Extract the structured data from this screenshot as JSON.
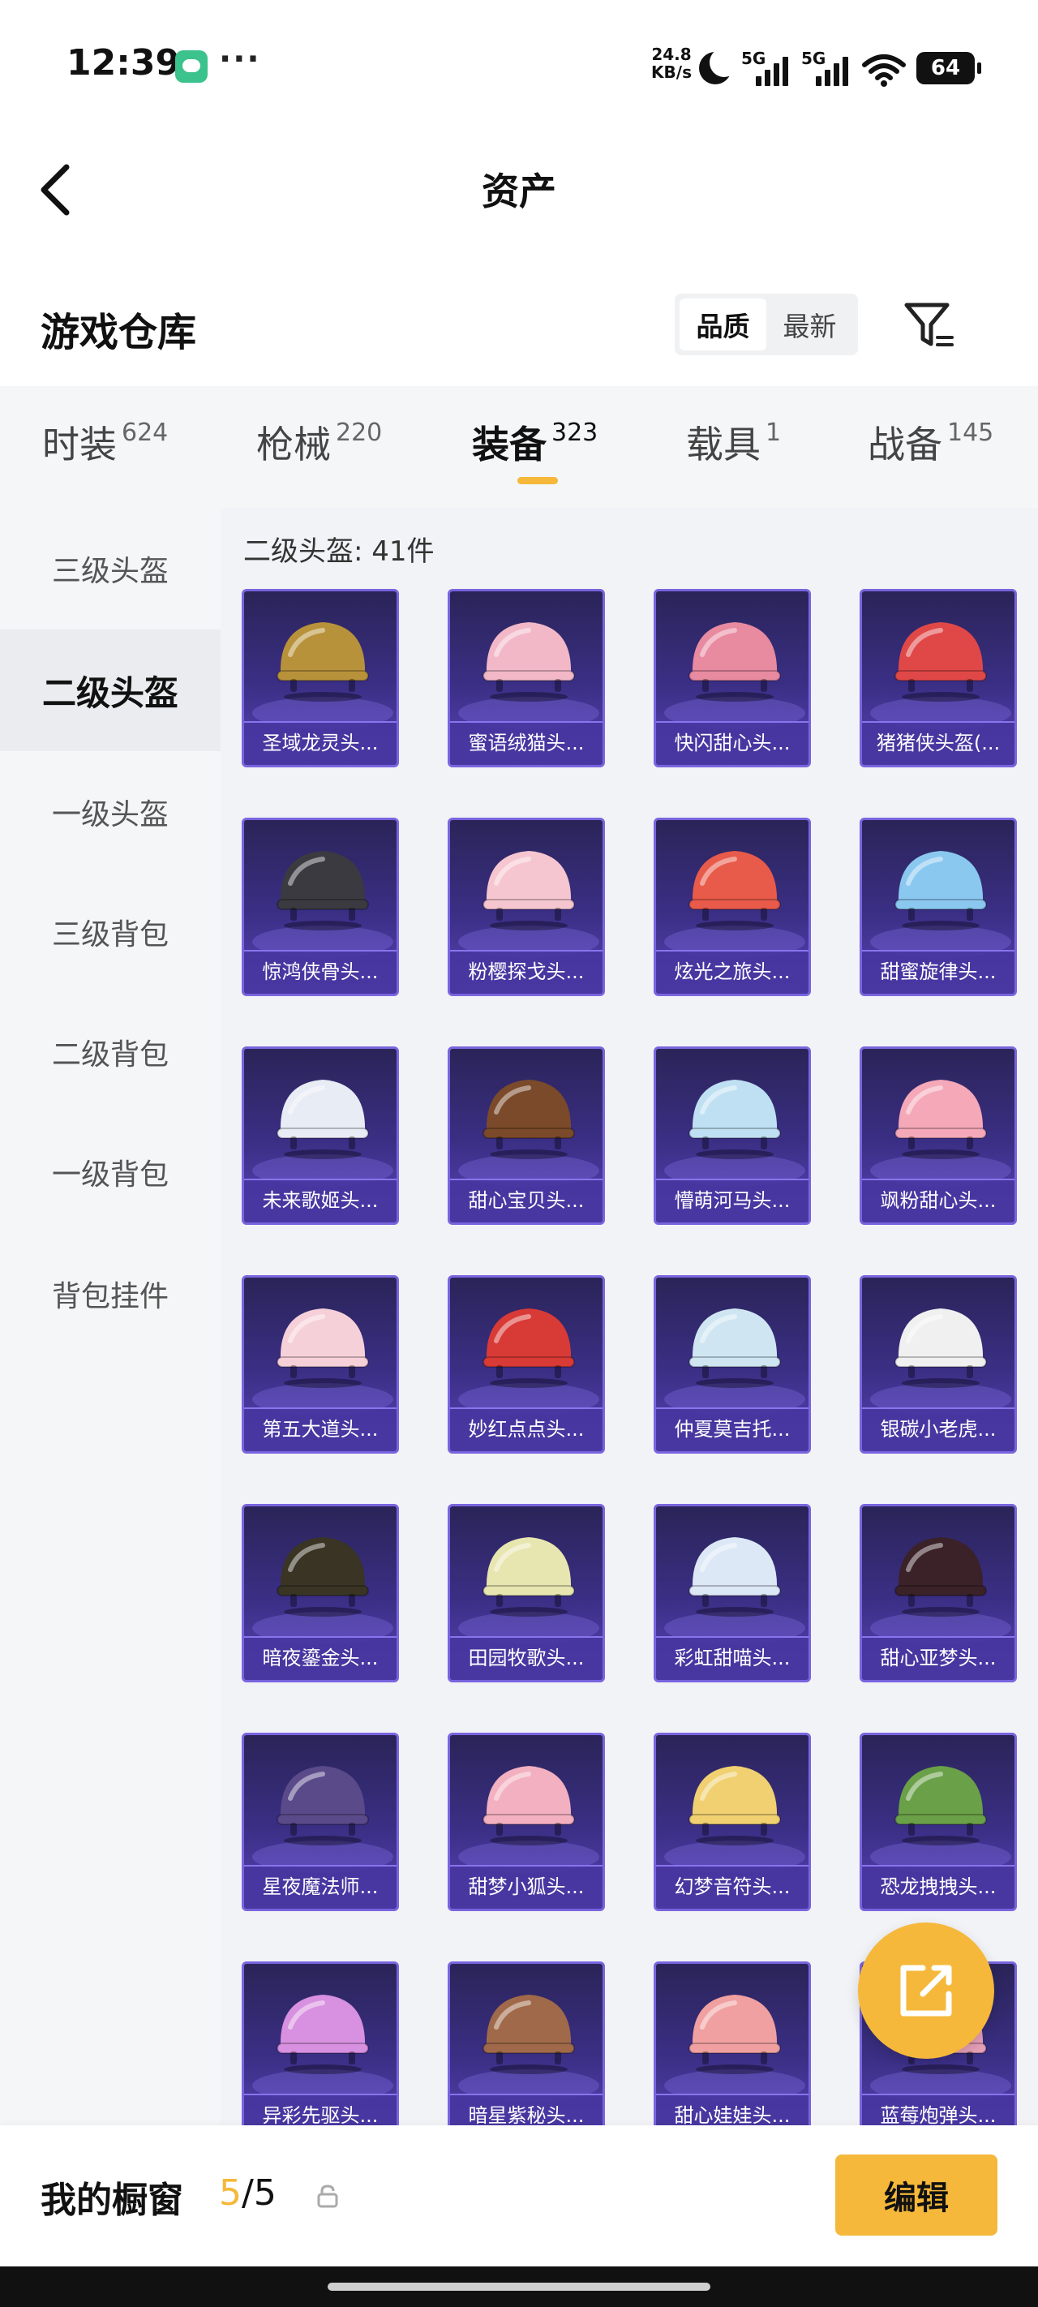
{
  "status_bar": {
    "time": "12:39",
    "more": "···",
    "net_speed_value": "24.8",
    "net_speed_unit": "KB/s",
    "signal1": "5G",
    "signal2": "5G",
    "battery": "64"
  },
  "header": {
    "title": "资产"
  },
  "section": {
    "title": "游戏仓库",
    "sort_options": [
      "品质",
      "最新"
    ],
    "active_sort": "品质"
  },
  "tabs": [
    {
      "label": "时装",
      "count": "624"
    },
    {
      "label": "枪械",
      "count": "220"
    },
    {
      "label": "装备",
      "count": "323"
    },
    {
      "label": "载具",
      "count": "1"
    },
    {
      "label": "战备",
      "count": "145"
    }
  ],
  "active_tab": "装备",
  "sidebar": {
    "items": [
      "三级头盔",
      "二级头盔",
      "一级头盔",
      "三级背包",
      "二级背包",
      "一级背包",
      "背包挂件"
    ],
    "active": "二级头盔"
  },
  "content": {
    "count_label": "二级头盔: 41件",
    "items": [
      {
        "name": "圣域龙灵头...",
        "color": "#b8923a"
      },
      {
        "name": "蜜语绒猫头...",
        "color": "#f2b8c8"
      },
      {
        "name": "快闪甜心头...",
        "color": "#e88aa0"
      },
      {
        "name": "猪猪侠头盔(...",
        "color": "#e04848"
      },
      {
        "name": "惊鸿侠骨头...",
        "color": "#3a3a40"
      },
      {
        "name": "粉樱探戈头...",
        "color": "#f6c6d0"
      },
      {
        "name": "炫光之旅头...",
        "color": "#e85a4a"
      },
      {
        "name": "甜蜜旋律头...",
        "color": "#8ac8f0"
      },
      {
        "name": "未来歌姬头...",
        "color": "#e8ecf4"
      },
      {
        "name": "甜心宝贝头...",
        "color": "#7a4a2a"
      },
      {
        "name": "懵萌河马头...",
        "color": "#bfe0f2"
      },
      {
        "name": "飒粉甜心头...",
        "color": "#f4a8b8"
      },
      {
        "name": "第五大道头...",
        "color": "#f6d0d8"
      },
      {
        "name": "妙红点点头...",
        "color": "#d83a36"
      },
      {
        "name": "仲夏莫吉托...",
        "color": "#cfe6f2"
      },
      {
        "name": "银碳小老虎...",
        "color": "#f0f0f0"
      },
      {
        "name": "暗夜鎏金头...",
        "color": "#3a3424"
      },
      {
        "name": "田园牧歌头...",
        "color": "#e8e6b0"
      },
      {
        "name": "彩虹甜喵头...",
        "color": "#dce8f6"
      },
      {
        "name": "甜心亚梦头...",
        "color": "#3a2228"
      },
      {
        "name": "星夜魔法师...",
        "color": "#5a4a8a"
      },
      {
        "name": "甜梦小狐头...",
        "color": "#f2b0c0"
      },
      {
        "name": "幻梦音符头...",
        "color": "#f0d070"
      },
      {
        "name": "恐龙拽拽头...",
        "color": "#6aa048"
      },
      {
        "name": "异彩先驱头...",
        "color": "#d890e0"
      },
      {
        "name": "暗星紫秘头...",
        "color": "#a06a4a"
      },
      {
        "name": "甜心娃娃头...",
        "color": "#f0a0a0"
      },
      {
        "name": "蓝莓炮弹头...",
        "color": "#e8a0b8"
      }
    ]
  },
  "bottom_bar": {
    "title": "我的橱窗",
    "used": "5",
    "total": "/5",
    "edit_label": "编辑"
  },
  "colors": {
    "accent": "#f5b83a",
    "card": "#3b2f86"
  }
}
